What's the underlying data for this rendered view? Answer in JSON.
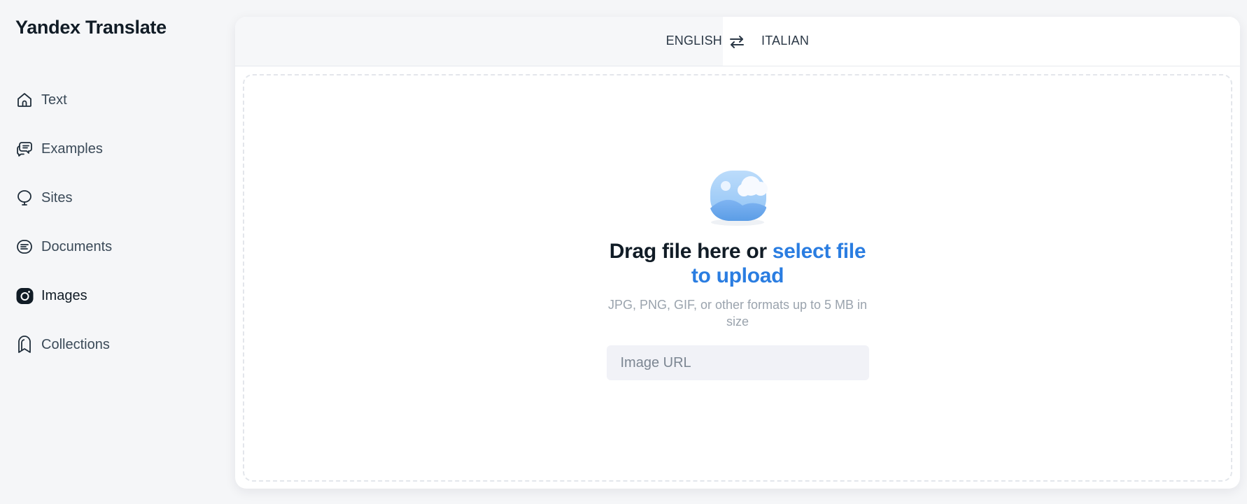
{
  "app": {
    "title": "Yandex Translate"
  },
  "sidebar": {
    "items": [
      {
        "label": "Text",
        "icon": "home-icon",
        "active": false
      },
      {
        "label": "Examples",
        "icon": "chat-bubbles-icon",
        "active": false
      },
      {
        "label": "Sites",
        "icon": "globe-balloon-icon",
        "active": false
      },
      {
        "label": "Documents",
        "icon": "document-lines-icon",
        "active": false
      },
      {
        "label": "Images",
        "icon": "camera-icon",
        "active": true
      },
      {
        "label": "Collections",
        "icon": "bookmark-icon",
        "active": false
      }
    ]
  },
  "languages": {
    "source": "ENGLISH",
    "target": "ITALIAN",
    "swap_icon": "swap-arrows-icon"
  },
  "upload": {
    "illustration_icon": "image-landscape-icon",
    "title_prefix": "Drag file here or ",
    "title_link": "select file to upload",
    "hint": "JPG, PNG, GIF, or other formats up to 5 MB in size",
    "url_placeholder": "Image URL",
    "url_value": ""
  },
  "colors": {
    "accent": "#2a7de1",
    "background": "#f5f6f8",
    "panel": "#ffffff",
    "text_dark": "#111c26",
    "hint": "#9aa3ad",
    "input_bg": "#f1f2f7"
  }
}
